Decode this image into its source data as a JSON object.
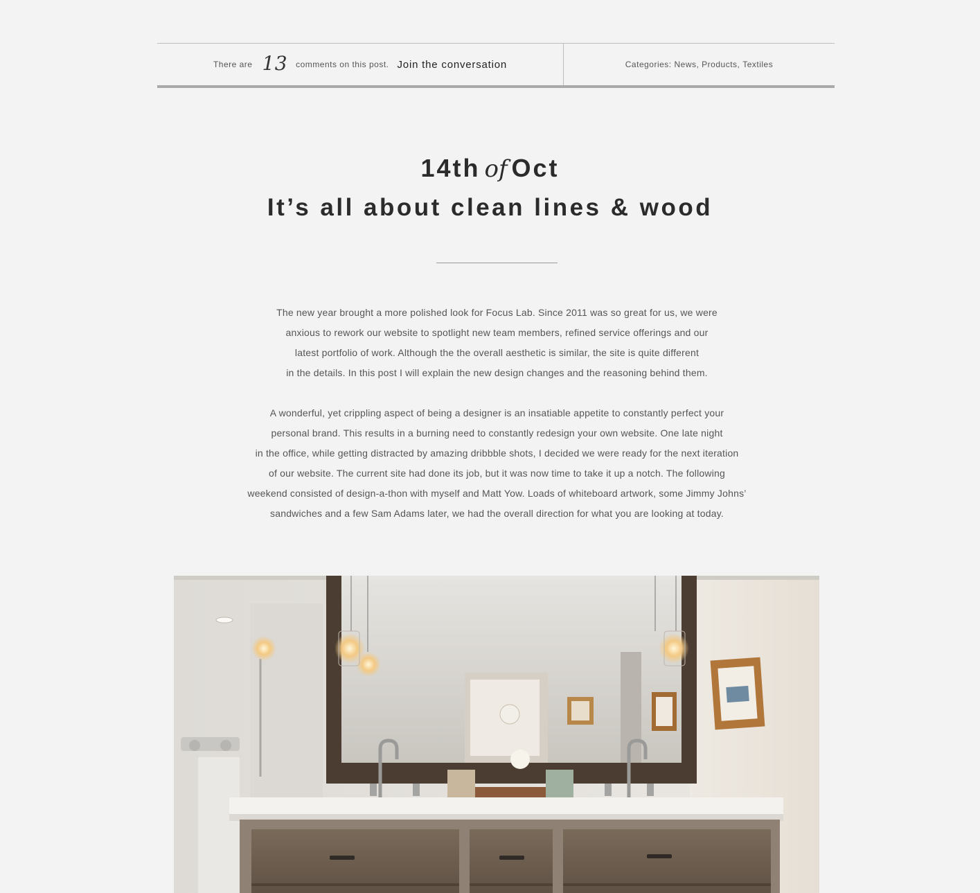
{
  "meta": {
    "comments_prefix": "There are",
    "comments_count": "13",
    "comments_suffix": "comments on this post.",
    "join_link": "Join the conversation",
    "categories_label": "Categories:",
    "categories": [
      "News",
      "Products",
      "Textiles"
    ]
  },
  "post": {
    "date_day": "14th",
    "date_of": "of",
    "date_month": "Oct",
    "title": "It’s all about clean lines & wood",
    "paragraph1": [
      "The new year brought a more polished look for Focus Lab. Since 2011 was so great for us, we were",
      "anxious to rework our website to spotlight new team members, refined service offerings and our",
      "latest portfolio of work. Although the the overall aesthetic is similar, the site is quite different",
      "in the details. In this post I will explain the new design changes and the reasoning behind them."
    ],
    "paragraph2": [
      "A wonderful, yet crippling aspect of being a designer is an insatiable appetite to constantly perfect your",
      "personal brand. This results in a burning need to constantly redesign your own website. One late night",
      "in the office, while getting distracted by amazing dribbble shots, I decided we were ready for the next iteration",
      "of our website. The current site had done its job, but it was now time to take it up a notch. The following",
      "weekend consisted of design-a-thon with myself and Matt Yow. Loads of whiteboard artwork, some Jimmy Johns’",
      "sandwiches and a few Sam Adams later, we had the overall direction for what you are looking at today."
    ]
  },
  "colors": {
    "background": "#f3f3f3",
    "heading": "#2b2b2b",
    "body": "#555555",
    "wood": "#6b5a4a"
  }
}
